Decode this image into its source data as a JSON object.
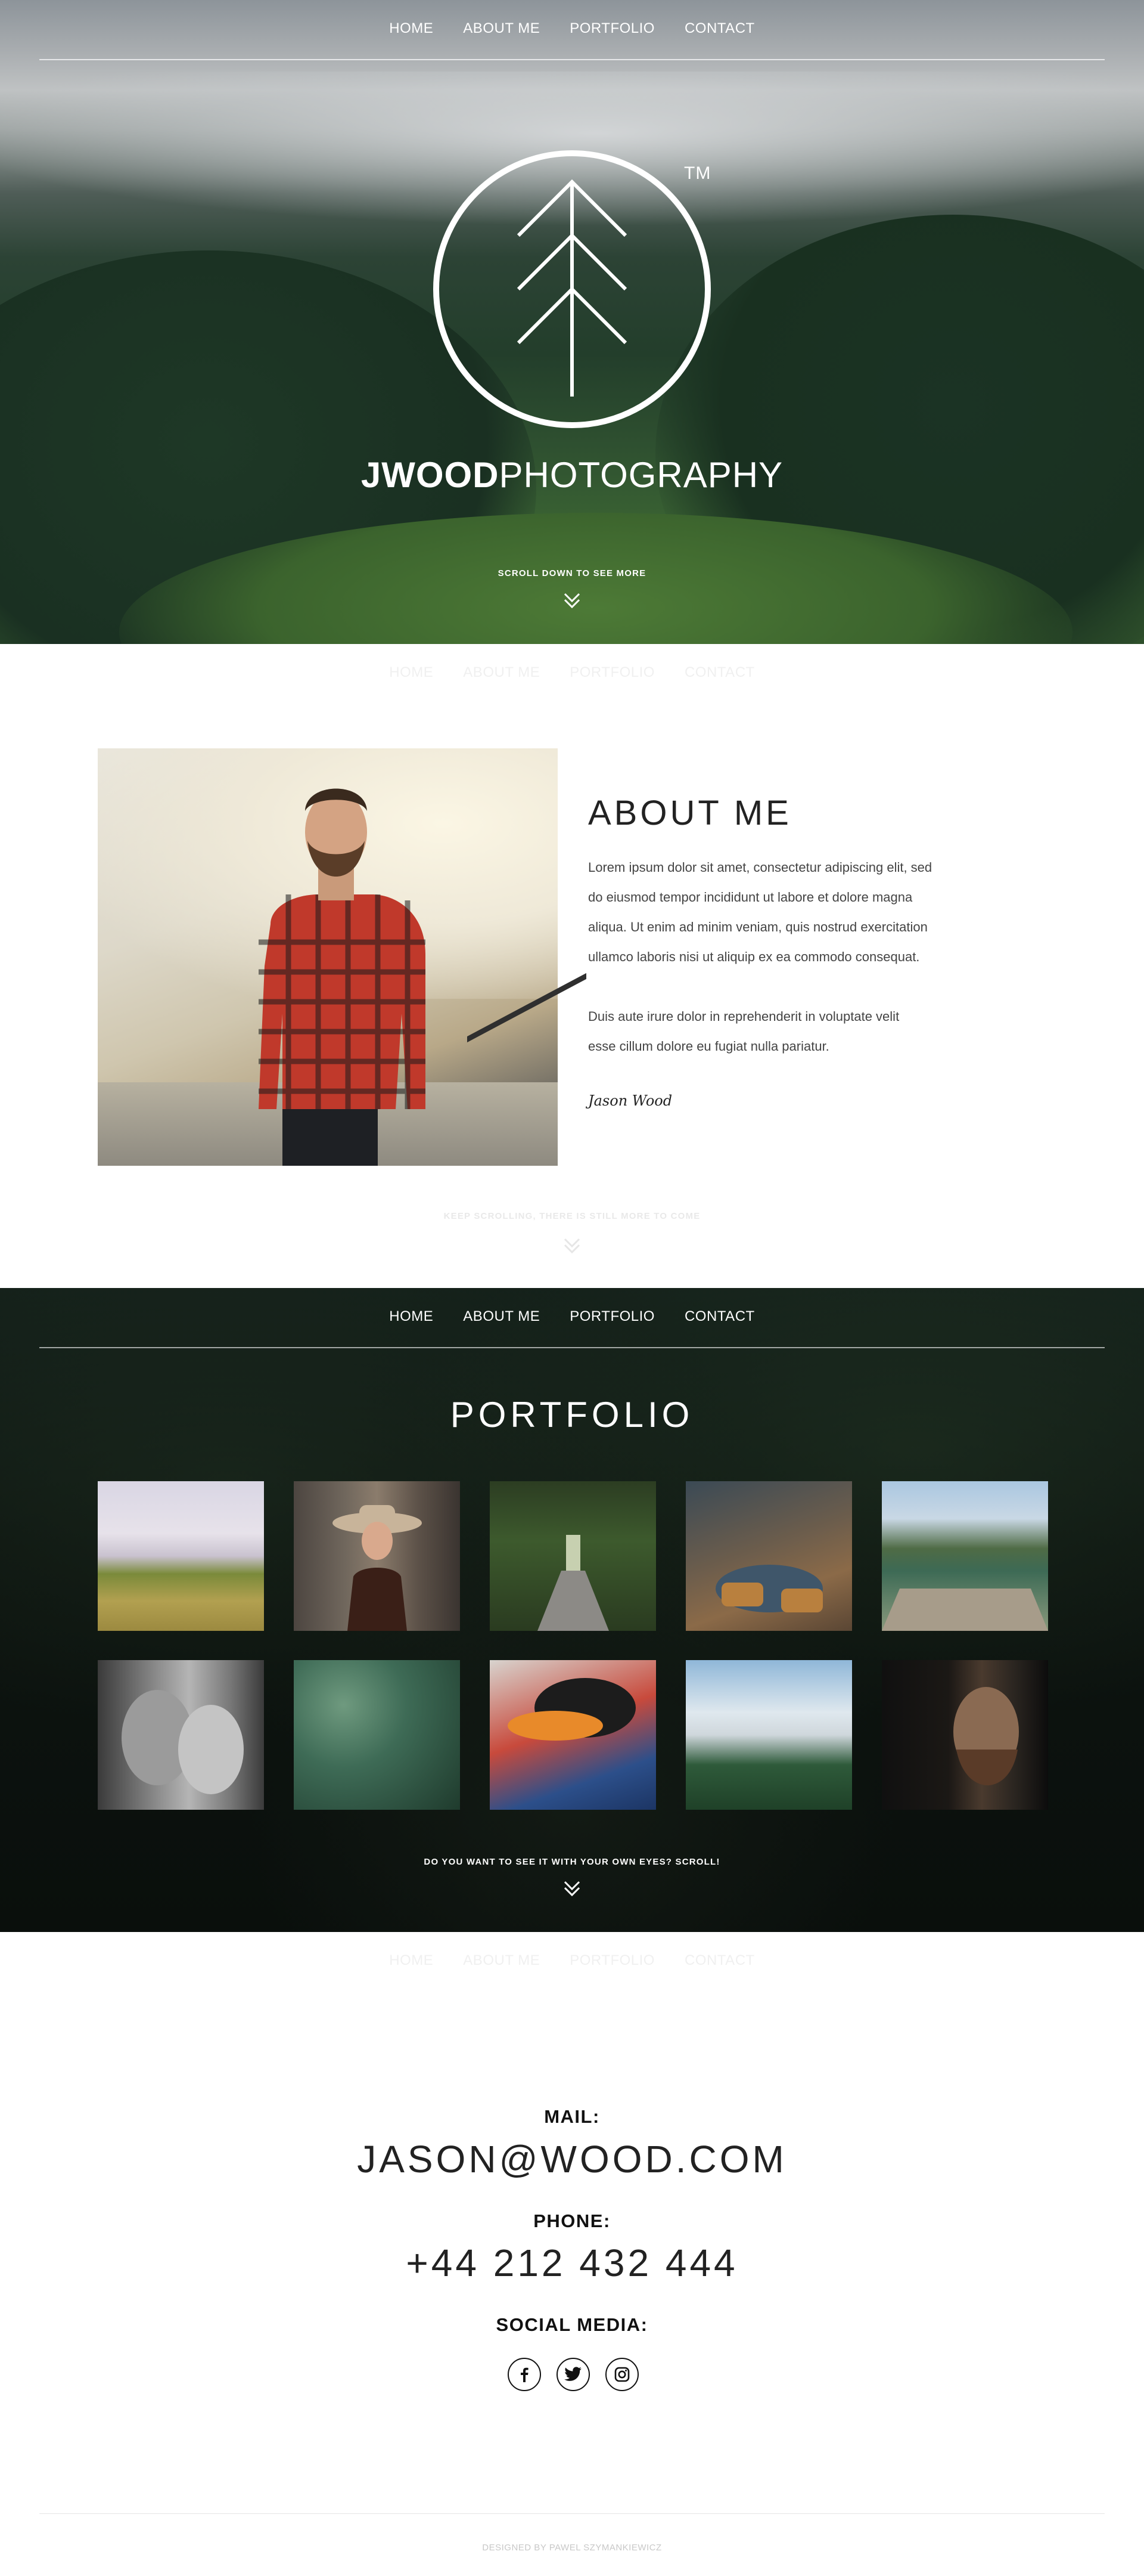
{
  "nav": {
    "items": [
      "HOME",
      "ABOUT ME",
      "PORTFOLIO",
      "CONTACT"
    ]
  },
  "hero": {
    "tm": "TM",
    "brand_bold": "JWOOD",
    "brand_light": "PHOTOGRAPHY",
    "scroll_hint": "SCROLL DOWN TO SEE MORE"
  },
  "about": {
    "title": "ABOUT ME",
    "paragraph1_lines": [
      "Lorem ipsum dolor sit amet, consectetur adipiscing elit, sed",
      "do eiusmod tempor incididunt ut labore et dolore magna",
      "aliqua. Ut enim ad minim veniam, quis nostrud exercitation",
      "ullamco laboris nisi ut aliquip ex ea commodo consequat."
    ],
    "paragraph2_lines": [
      "Duis aute irure dolor in reprehenderit in voluptate velit",
      "esse cillum dolore eu fugiat nulla pariatur."
    ],
    "signature": "Jason Wood",
    "scroll_hint": "KEEP SCROLLING, THERE IS STILL MORE TO COME"
  },
  "portfolio": {
    "title": "PORTFOLIO",
    "scroll_hint": "DO YOU WANT TO SEE IT WITH YOUR OWN EYES? SCROLL!",
    "thumbnails": [
      {
        "subject": "foggy-hill-landscape"
      },
      {
        "subject": "woman-in-hat-portrait"
      },
      {
        "subject": "forest-bridge"
      },
      {
        "subject": "sitting-boots"
      },
      {
        "subject": "mountain-lake-dock"
      },
      {
        "subject": "couple-bw-portrait"
      },
      {
        "subject": "succulent-plants"
      },
      {
        "subject": "man-in-cap"
      },
      {
        "subject": "snowy-mountain-forest"
      },
      {
        "subject": "bearded-man-dark-portrait"
      }
    ]
  },
  "contact": {
    "mail_label": "MAIL:",
    "mail_value": "JASON@WOOD.COM",
    "phone_label": "PHONE:",
    "phone_value": "+44 212 432 444",
    "social_label": "SOCIAL MEDIA:",
    "socials": [
      "facebook",
      "twitter",
      "instagram"
    ],
    "credit": "DESIGNED BY PAWEL SZYMANKIEWICZ"
  },
  "colors": {
    "white": "#ffffff",
    "dark": "#0a0f0c",
    "text": "#444444",
    "heading": "#222222"
  }
}
